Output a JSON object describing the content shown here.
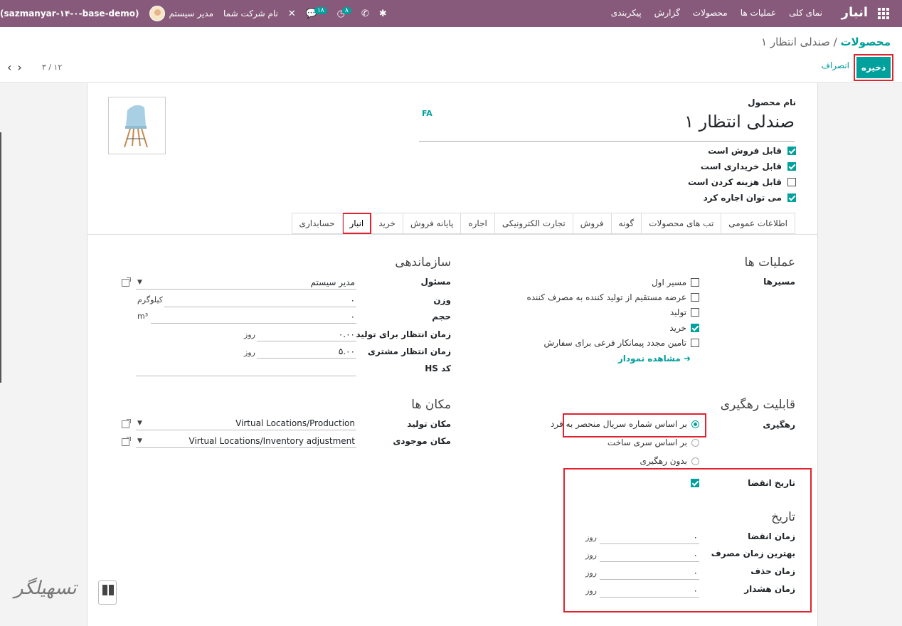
{
  "nav": {
    "brand": "انبار",
    "menu": [
      "نمای کلی",
      "عملیات ها",
      "محصولات",
      "گزارش",
      "پیکربندی"
    ],
    "company": "نام شرکت شما",
    "user": "مدیر سیستم",
    "db": "(sazmanyar-۱۴-۰-base-demo)",
    "activity_count": "۸",
    "messages_count": "۱۸"
  },
  "breadcrumb": {
    "parent": "محصولات",
    "separator": "/",
    "current": "صندلی انتظار ۱"
  },
  "buttons": {
    "save": "ذخیره",
    "discard": "انصراف"
  },
  "pager": {
    "value": "۳ / ۱۲"
  },
  "product": {
    "name_label": "نام محصول",
    "name": "صندلی انتظار ۱",
    "lang": "FA",
    "flags": [
      {
        "label": "قابل فروش است",
        "checked": true
      },
      {
        "label": "قابل خریداری است",
        "checked": true
      },
      {
        "label": "قابل هزینه کردن است",
        "checked": false
      },
      {
        "label": "می توان اجاره کرد",
        "checked": true
      }
    ]
  },
  "tabs": [
    "اطلاعات عمومی",
    "تب های محصولات",
    "گونه",
    "فروش",
    "تجارت الکترونیکی",
    "اجاره",
    "پایانه فروش",
    "خرید",
    "انبار",
    "حسابداری"
  ],
  "operations": {
    "title": "عملیات ها",
    "routes_label": "مسیرها",
    "routes": [
      {
        "label": "مسیر اول",
        "checked": false
      },
      {
        "label": "عرضه مستقیم از تولید کننده به مصرف کننده",
        "checked": false
      },
      {
        "label": "تولید",
        "checked": false
      },
      {
        "label": "خرید",
        "checked": true
      },
      {
        "label": "تامین مجدد پیمانکار فرعی برای سفارش",
        "checked": false
      }
    ],
    "diagram_link": "مشاهده نمودار"
  },
  "org": {
    "title": "سازماندهی",
    "responsible_label": "مسئول",
    "responsible": "مدیر سیستم",
    "weight_label": "وزن",
    "weight": "۰",
    "weight_unit": "کیلوگرم",
    "volume_label": "حجم",
    "volume": "۰",
    "volume_unit": "m³",
    "mfg_lead_label": "زمان انتظار برای تولید",
    "mfg_lead": "۰.۰۰",
    "mfg_lead_unit": "روز",
    "cust_lead_label": "زمان انتظار مشتری",
    "cust_lead": "۵.۰۰",
    "cust_lead_unit": "روز",
    "hs_label": "کد HS",
    "hs": ""
  },
  "tracking": {
    "title": "قابلیت رهگیری",
    "label": "رهگیری",
    "options": [
      {
        "label": "بر اساس شماره سریال منحصر به فرد",
        "selected": true
      },
      {
        "label": "بر اساس سری ساخت",
        "selected": false
      },
      {
        "label": "بدون رهگیری",
        "selected": false
      }
    ],
    "expiry_label": "تاریخ انقضا",
    "expiry_checked": true
  },
  "locations": {
    "title": "مکان ها",
    "production_label": "مکان تولید",
    "production": "Virtual Locations/Production",
    "inventory_label": "مکان موجودی",
    "inventory": "Virtual Locations/Inventory adjustment"
  },
  "dates": {
    "title": "تاریخ",
    "rows": [
      {
        "label": "زمان انقضا",
        "value": "۰",
        "unit": "روز"
      },
      {
        "label": "بهترین زمان مصرف",
        "value": "۰",
        "unit": "روز"
      },
      {
        "label": "زمان حذف",
        "value": "۰",
        "unit": "روز"
      },
      {
        "label": "زمان هشدار",
        "value": "۰",
        "unit": "روز"
      }
    ]
  },
  "watermark": "تسهیلگر"
}
